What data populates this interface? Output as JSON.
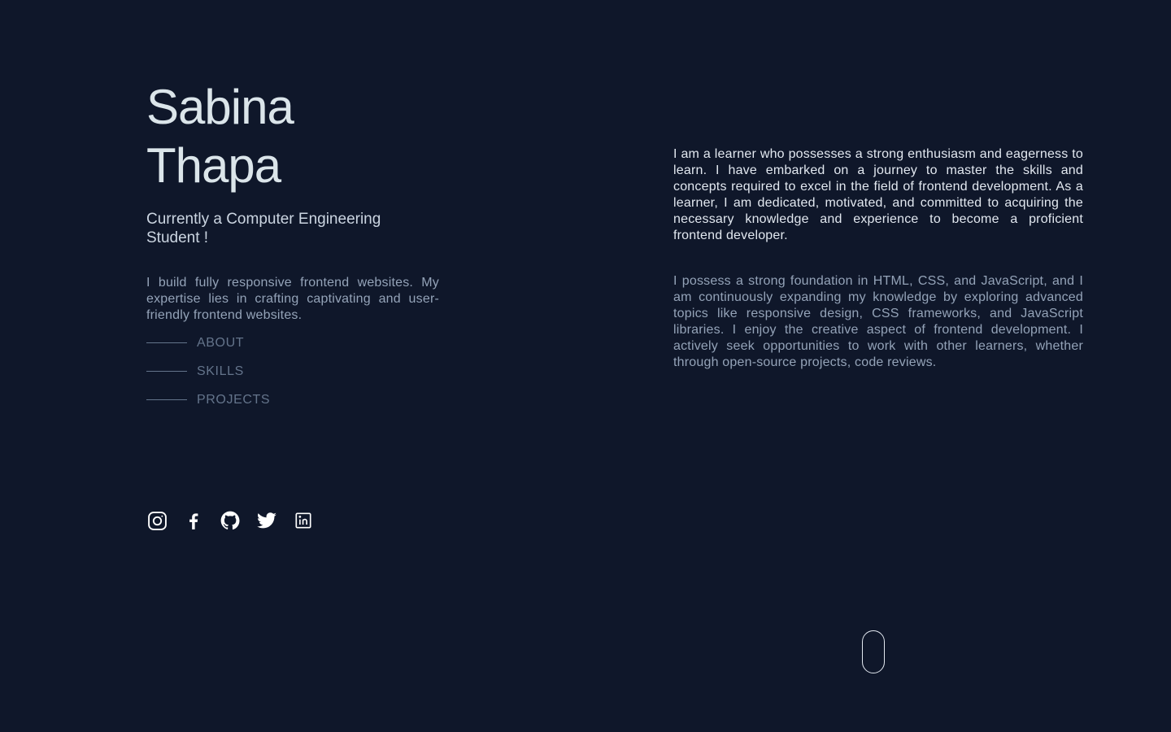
{
  "header": {
    "name": "Sabina Thapa",
    "tagline": "Currently a Computer Engineering Student !",
    "intro": "I build fully responsive frontend websites. My expertise lies in crafting captivating and user-friendly frontend websites."
  },
  "nav": {
    "items": [
      {
        "label": "ABOUT"
      },
      {
        "label": "SKILLS"
      },
      {
        "label": "PROJECTS"
      }
    ]
  },
  "socials": [
    {
      "icon": "instagram-icon"
    },
    {
      "icon": "facebook-icon"
    },
    {
      "icon": "github-icon"
    },
    {
      "icon": "twitter-icon"
    },
    {
      "icon": "linkedin-icon"
    }
  ],
  "about": {
    "paragraph1": "I am a learner who possesses a strong enthusiasm and eagerness to learn. I have embarked on a journey to master the skills and concepts required to excel in the field of frontend development. As a learner, I am dedicated, motivated, and committed to acquiring the necessary knowledge and experience to become a proficient frontend developer.",
    "paragraph2": "I possess a strong foundation in HTML, CSS, and JavaScript, and I am continuously expanding my knowledge by exploring advanced topics like responsive design, CSS frameworks, and JavaScript libraries. I enjoy the creative aspect of frontend development. I actively seek opportunities to work with other learners, whether through open-source projects, code reviews."
  },
  "colors": {
    "background": "#0f172a",
    "heading": "#dbe5ea",
    "muted": "#94a3b8",
    "nav": "#64748b"
  }
}
